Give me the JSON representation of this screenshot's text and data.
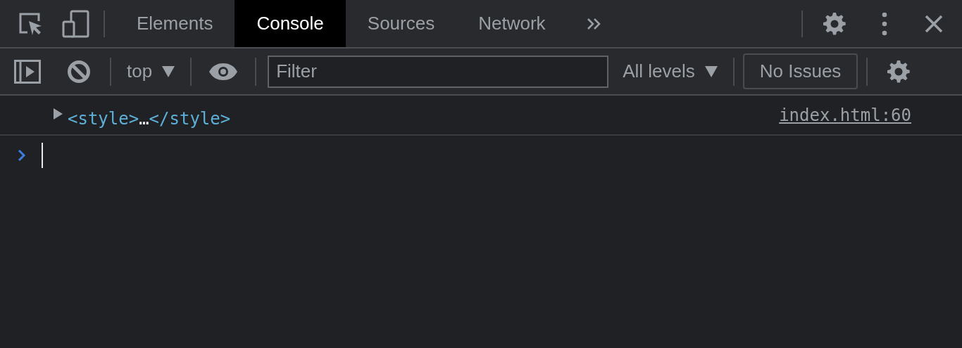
{
  "tabs": [
    {
      "label": "Elements",
      "selected": false
    },
    {
      "label": "Console",
      "selected": true
    },
    {
      "label": "Sources",
      "selected": false
    },
    {
      "label": "Network",
      "selected": false
    }
  ],
  "toolbar": {
    "context": "top",
    "filter": {
      "placeholder": "Filter"
    },
    "levels": "All levels",
    "issues": "No Issues"
  },
  "messages": [
    {
      "expanded": false,
      "open_tag": "<style>",
      "ellipsis": "…",
      "close_tag": "</style>",
      "source": "index.html:60"
    }
  ]
}
